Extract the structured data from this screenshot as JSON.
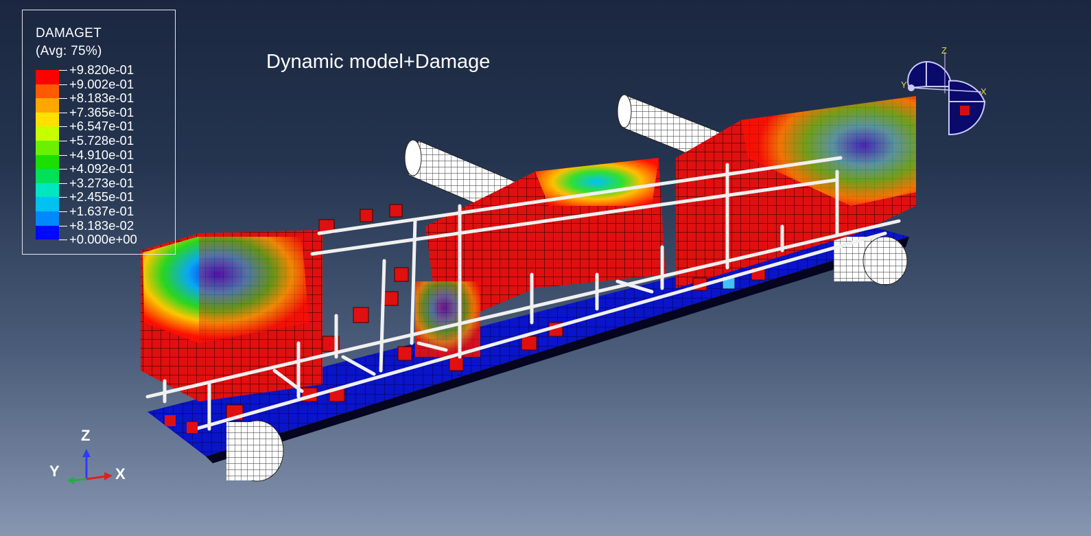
{
  "legend": {
    "variable": "DAMAGET",
    "averaging": "(Avg: 75%)",
    "levels": [
      {
        "label": "+9.820e-01",
        "color": "#ff0000"
      },
      {
        "label": "+9.002e-01",
        "color": "#ff5a00"
      },
      {
        "label": "+8.183e-01",
        "color": "#ffa600"
      },
      {
        "label": "+7.365e-01",
        "color": "#ffe000"
      },
      {
        "label": "+6.547e-01",
        "color": "#c6ff00"
      },
      {
        "label": "+5.728e-01",
        "color": "#6cf000"
      },
      {
        "label": "+4.910e-01",
        "color": "#19e000"
      },
      {
        "label": "+4.092e-01",
        "color": "#00e05a"
      },
      {
        "label": "+3.273e-01",
        "color": "#00e6c0"
      },
      {
        "label": "+2.455e-01",
        "color": "#00c2f0"
      },
      {
        "label": "+1.637e-01",
        "color": "#0088ff"
      },
      {
        "label": "+8.183e-02",
        "color": "#004cff"
      },
      {
        "label": "+0.000e+00",
        "color": "#0008ff"
      }
    ]
  },
  "viewport": {
    "title": "Dynamic model+Damage"
  },
  "triad": {
    "z": "Z",
    "y": "Y",
    "x": "X"
  },
  "view_cube": {
    "z": "Z",
    "y": "Y",
    "x": "X"
  },
  "colors": {
    "damage_high": "#e01010",
    "damage_low": "#0a10c8",
    "rebar": "#f0f0f0",
    "roller": "#ffffff"
  }
}
